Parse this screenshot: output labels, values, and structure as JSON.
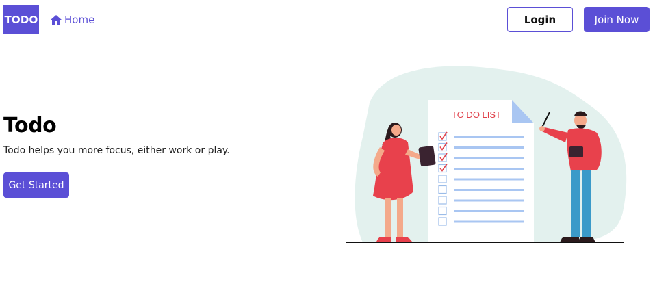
{
  "navbar": {
    "brand": "TODO",
    "home_label": "Home",
    "login_label": "Login",
    "join_label": "Join Now",
    "accent_color": "#5b4fd6"
  },
  "hero": {
    "title": "Todo",
    "description": "Todo helps you more focus, either work or play.",
    "cta_label": "Get Started"
  },
  "illustration": {
    "list_title": "TO DO LIST",
    "checked_items": 4,
    "total_items": 9
  }
}
